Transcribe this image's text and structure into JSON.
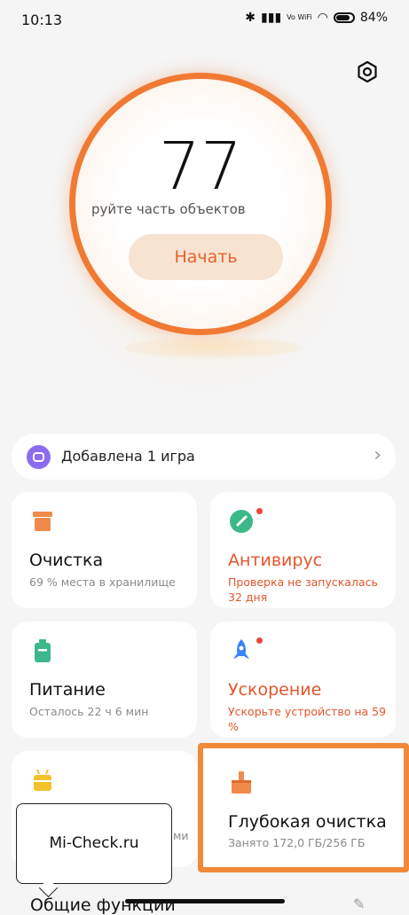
{
  "status_bar": {
    "time": "10:13",
    "network_label": "Vo WiFi",
    "battery": "84%"
  },
  "score": {
    "value": "77",
    "hint": "руйте часть объектов",
    "start_label": "Начать"
  },
  "game_banner": {
    "text": "Добавлена 1 игра"
  },
  "cards": {
    "cleanup": {
      "title": "Очистка",
      "subtitle": "69 % места в хранилище"
    },
    "antivirus": {
      "title": "Антивирус",
      "subtitle": "Проверка не запускалась 32 дня"
    },
    "battery": {
      "title": "Питание",
      "subtitle": "Осталось 22 ч 6 мин"
    },
    "boost": {
      "title": "Ускорение",
      "subtitle": "Ускорьте устройство на 59 %"
    },
    "deep_clean": {
      "title": "Глубокая очистка",
      "subtitle": "Занято 172,0 ГБ/256 ГБ"
    },
    "hidden_card": {
      "partial_text": "ми"
    }
  },
  "tooltip": {
    "text": "Mi-Check.ru"
  },
  "bottom": {
    "partial_label": "Общие функции"
  },
  "colors": {
    "accent": "#f07a34",
    "warning": "#e4562b",
    "icon_orange": "#f08a4b",
    "icon_teal": "#3db889",
    "icon_blue": "#3a82f7",
    "icon_yellow": "#f4c22b",
    "icon_purple": "#8b6cf0"
  }
}
